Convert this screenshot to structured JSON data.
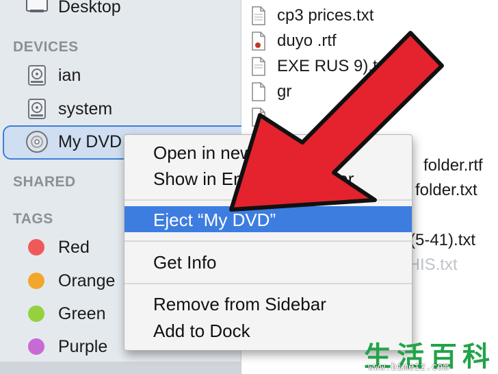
{
  "sidebar": {
    "desktop_label": "Desktop",
    "devices_header": "DEVICES",
    "devices": [
      {
        "label": "ian",
        "icon": "hard-drive-icon"
      },
      {
        "label": "system",
        "icon": "hard-drive-icon"
      },
      {
        "label": "My DVD",
        "icon": "dvd-disc-icon"
      }
    ],
    "shared_header": "SHARED",
    "tags_header": "TAGS",
    "tags": [
      {
        "label": "Red",
        "color": "#f0595a"
      },
      {
        "label": "Orange",
        "color": "#f4a52c"
      },
      {
        "label": "Green",
        "color": "#95d13d"
      },
      {
        "label": "Purple",
        "color": "#c86ad6"
      }
    ]
  },
  "files": [
    {
      "name": "cp3 prices.txt",
      "type": "txt"
    },
    {
      "name": "duyo   .rtf",
      "type": "rtf"
    },
    {
      "name": "EXE    RUS        9).txt",
      "type": "txt"
    },
    {
      "name": "gr",
      "type": "txt"
    },
    {
      "name": "",
      "type": "txt"
    },
    {
      "name": "folder.rtf",
      "type": "rtf"
    },
    {
      "name": "folder.txt",
      "type": "txt"
    },
    {
      "name": "(5-41).txt",
      "type": "txt"
    },
    {
      "name": "License - READ THIS.txt",
      "type": "txt"
    }
  ],
  "context_menu": {
    "items": [
      {
        "label": "Open in new tab"
      },
      {
        "label": "Show in Enclosing Folder"
      },
      {
        "label": "Eject “My DVD”",
        "highlighted": true
      },
      {
        "label": "Get Info"
      },
      {
        "label": "Remove from Sidebar"
      },
      {
        "label": "Add to Dock"
      }
    ]
  },
  "overlay": {
    "arrow_color": "#e4232e",
    "watermark_url": "www.bimeiz.com",
    "watermark_chars": "生活百科"
  }
}
